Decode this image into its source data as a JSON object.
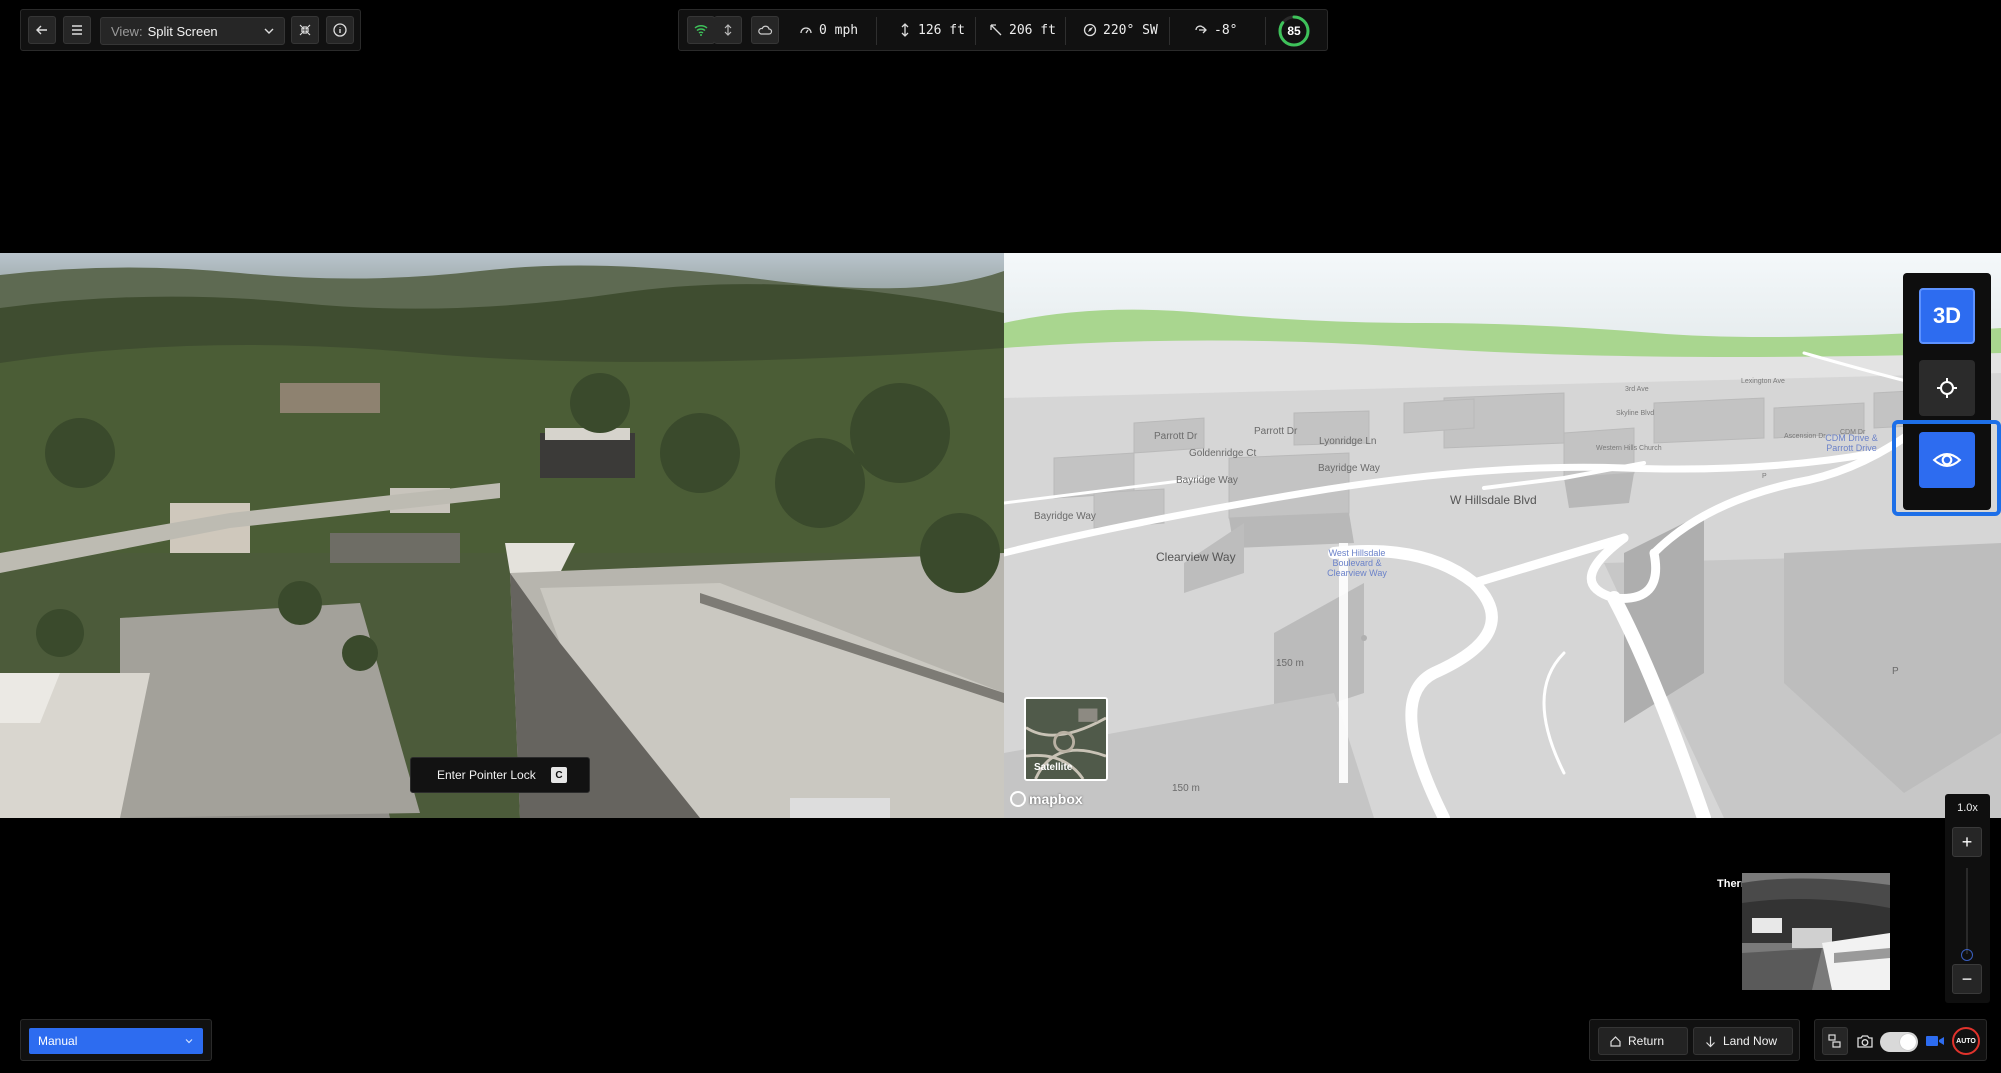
{
  "toolbar": {
    "view_label": "View:",
    "view_value": "Split Screen",
    "icons": [
      "back-arrow-icon",
      "menu-icon",
      "chevron-down-icon",
      "collapse-icon",
      "info-icon"
    ]
  },
  "telemetry": {
    "speed": "0 mph",
    "altitude": "126 ft",
    "distance": "206 ft",
    "heading": "220° SW",
    "gimbal_pitch": "-8°",
    "battery_percent": 85
  },
  "video": {
    "pointer_lock_label": "Enter Pointer Lock",
    "pointer_lock_key": "C"
  },
  "map": {
    "streets": {
      "parrott_dr_1": "Parrott Dr",
      "parrott_dr_2": "Parrott Dr",
      "goldenridge_ct": "Goldenridge Ct",
      "lyonridge_ln": "Lyonridge Ln",
      "bayridge_way_1": "Bayridge Way",
      "bayridge_way_2": "Bayridge Way",
      "bayridge_way_3": "Bayridge Way",
      "w_hillsdale_blvd": "W Hillsdale Blvd",
      "clearview_way": "Clearview Way",
      "skyline_blvd": "Skyline Blvd",
      "lexington_ave": "Lexington Ave",
      "3rd_ave": "3rd Ave",
      "ascension_dr": "Ascension Dr",
      "cdm_dr": "CDM Dr",
      "cdm_drive_parrott": "CDM Drive & Parrott Drive"
    },
    "poi": {
      "church": "Western Hills Church",
      "bus_stop": "West Hillsdale Boulevard & Clearview Way"
    },
    "contours": [
      "150 m",
      "150 m"
    ],
    "parking_symbols": [
      "P",
      "P"
    ],
    "satellite_label": "Satellite",
    "attribution": "mapbox"
  },
  "map_controls": {
    "mode_3d": "3D",
    "icons": [
      "crosshair-icon",
      "eye-icon"
    ]
  },
  "zoom": {
    "level": "1.0x",
    "plus": "+",
    "minus": "−"
  },
  "thermal": {
    "label": "Thermal"
  },
  "flight_mode": {
    "value": "Manual"
  },
  "actions": {
    "return_label": "Return",
    "land_label": "Land Now"
  },
  "camera": {
    "auto_label": "AUTO"
  },
  "colors": {
    "accent": "#2d6cf0",
    "battery": "#3ec25a",
    "record_red": "#e0332c"
  }
}
